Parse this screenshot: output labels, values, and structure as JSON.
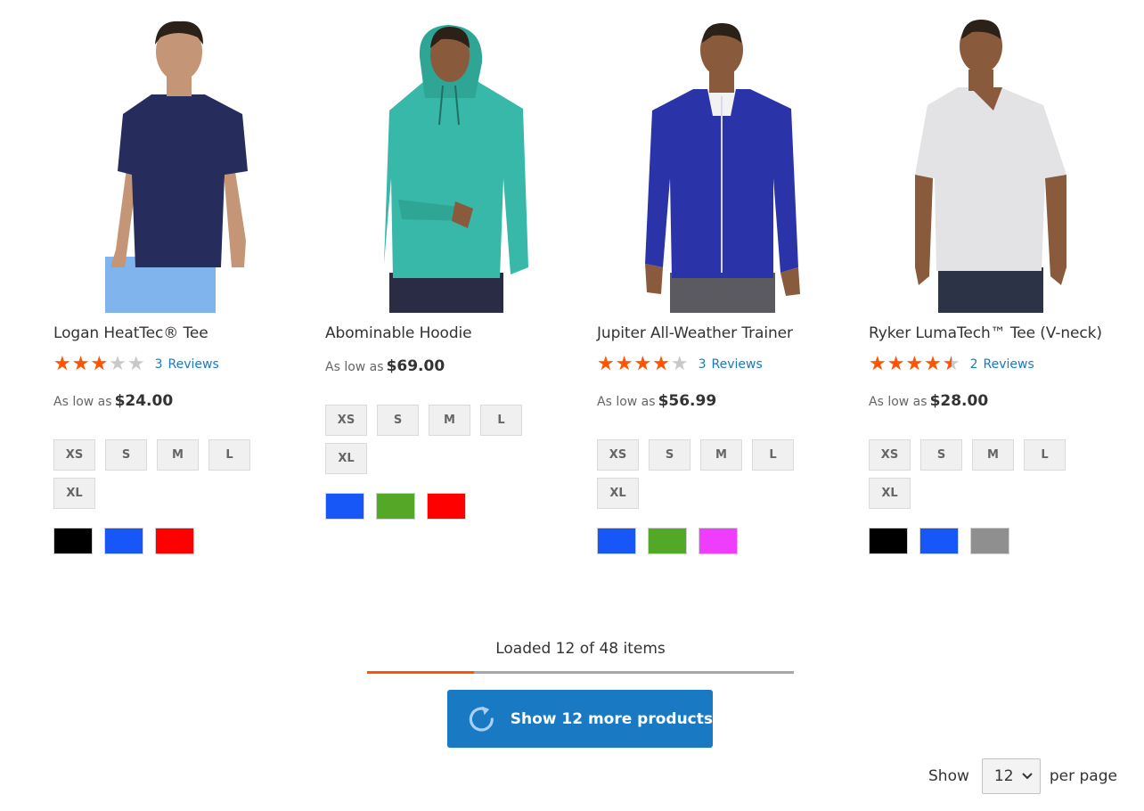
{
  "products": [
    {
      "name": "Logan HeatTec® Tee",
      "rating_percent": 60,
      "reviews_count": "3",
      "reviews_label": "Reviews",
      "price_prefix": "As low as",
      "price": "$24.00",
      "sizes": [
        "XS",
        "S",
        "M",
        "L",
        "XL"
      ],
      "colors": [
        "#000000",
        "#1857f7",
        "#ff0000"
      ]
    },
    {
      "name": "Abominable Hoodie",
      "price_prefix": "As low as",
      "price": "$69.00",
      "sizes": [
        "XS",
        "S",
        "M",
        "L",
        "XL"
      ],
      "colors": [
        "#1857f7",
        "#53a828",
        "#ff0000"
      ]
    },
    {
      "name": "Jupiter All-Weather Trainer",
      "rating_percent": 80,
      "reviews_count": "3",
      "reviews_label": "Reviews",
      "price_prefix": "As low as",
      "price": "$56.99",
      "sizes": [
        "XS",
        "S",
        "M",
        "L",
        "XL"
      ],
      "colors": [
        "#1857f7",
        "#53a828",
        "#ef3dff"
      ]
    },
    {
      "name": "Ryker LumaTech™ Tee (V-neck)",
      "rating_percent": 90,
      "reviews_count": "2",
      "reviews_label": "Reviews",
      "price_prefix": "As low as",
      "price": "$28.00",
      "sizes": [
        "XS",
        "S",
        "M",
        "L",
        "XL"
      ],
      "colors": [
        "#000000",
        "#1857f7",
        "#8f8f8f"
      ]
    }
  ],
  "load_more": {
    "status_text": "Loaded 12 of 48 items",
    "progress_fraction": 0.25,
    "button_label": "Show 12 more products",
    "icon": "refresh-icon"
  },
  "toolbar": {
    "show_label": "Show",
    "limit_value": "12",
    "per_page_label": "per page"
  },
  "colors": {
    "accent": "#ff5501",
    "link": "#1979c3",
    "button": "#1979c3"
  }
}
